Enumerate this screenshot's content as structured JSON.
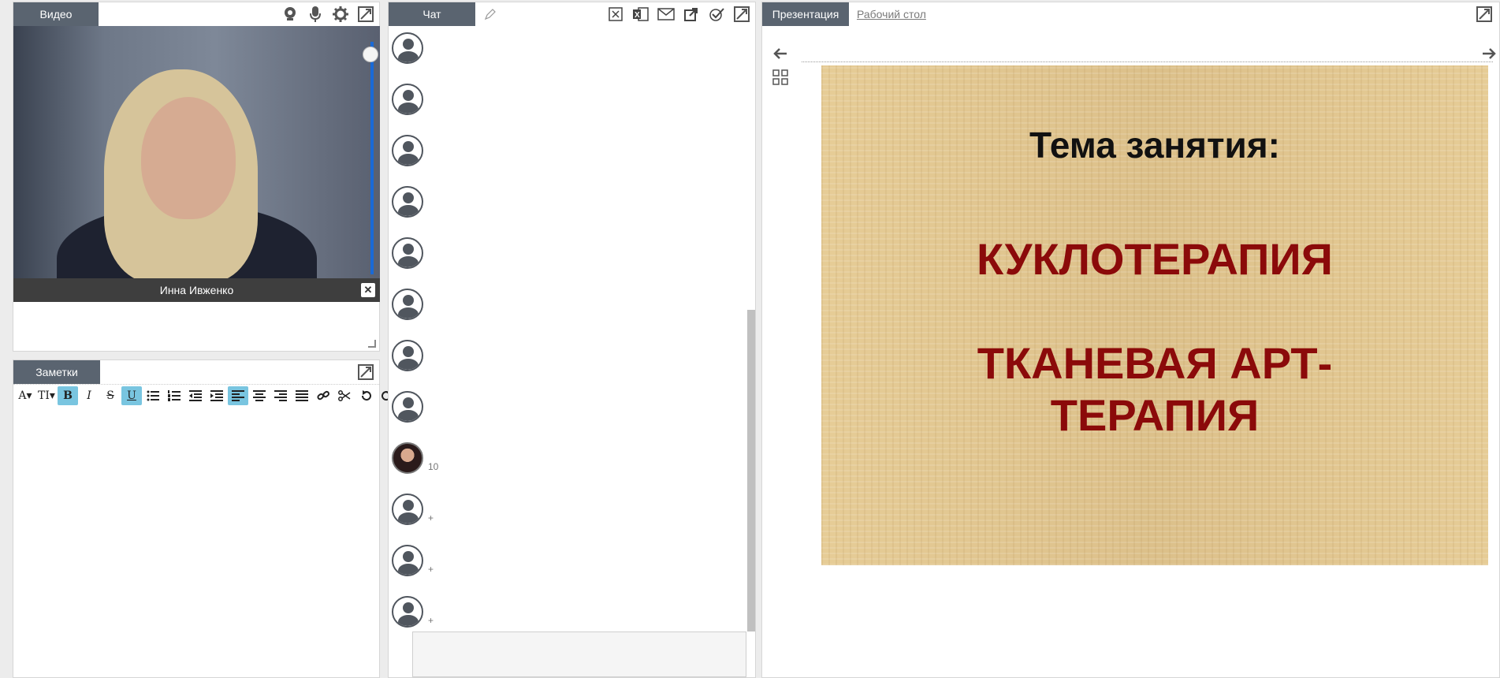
{
  "video": {
    "tab_label": "Видео",
    "participant_name": "Инна Ивженко",
    "close_symbol": "✕",
    "volume_level": 0.95,
    "icons": [
      "webcam-icon",
      "microphone-icon",
      "gear-icon",
      "expand-icon"
    ]
  },
  "notes": {
    "tab_label": "Заметки",
    "toolbar": {
      "font_color": "A▾",
      "text_size": "TI▾",
      "bold": "B",
      "italic": "I",
      "strike": "S",
      "underline": "U"
    },
    "content": ""
  },
  "chat": {
    "tab_label": "Чат",
    "messages": [
      {
        "avatar": "default",
        "text": ""
      },
      {
        "avatar": "default",
        "text": ""
      },
      {
        "avatar": "default",
        "text": ""
      },
      {
        "avatar": "default",
        "text": ""
      },
      {
        "avatar": "default",
        "text": ""
      },
      {
        "avatar": "default",
        "text": ""
      },
      {
        "avatar": "default",
        "text": ""
      },
      {
        "avatar": "default",
        "text": ""
      },
      {
        "avatar": "photo",
        "text": "10"
      },
      {
        "avatar": "default",
        "text": "+"
      },
      {
        "avatar": "default",
        "text": "+"
      },
      {
        "avatar": "default",
        "text": "+"
      }
    ],
    "input_value": ""
  },
  "presentation": {
    "tab_label": "Презентация",
    "second_tab_label": "Рабочий стол",
    "slide": {
      "title": "Тема занятия:",
      "line1": "КУКЛОТЕРАПИЯ",
      "line2": "ТКАНЕВАЯ АРТ-ТЕРАПИЯ"
    }
  },
  "colors": {
    "tab_bg": "#5a6470",
    "accent_blue": "#1a6ad6",
    "toolbar_active": "#79c5e0",
    "slide_text_red": "#8b0a0a"
  }
}
